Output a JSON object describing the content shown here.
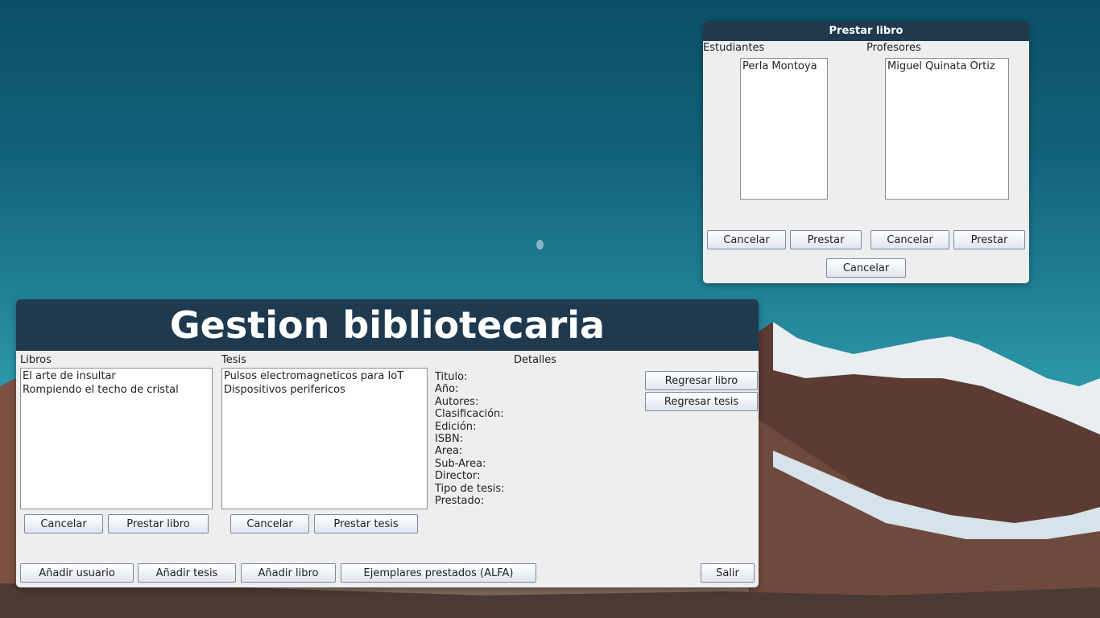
{
  "prestar_window": {
    "title": "Prestar libro",
    "students_label": "Estudiantes",
    "professors_label": "Profesores",
    "students": [
      "Perla Montoya"
    ],
    "professors": [
      "Miguel Quinata Ortiz"
    ],
    "buttons": {
      "cancel_students": "Cancelar",
      "lend_students": "Prestar",
      "cancel_professors": "Cancelar",
      "lend_professors": "Prestar",
      "cancel_bottom": "Cancelar"
    }
  },
  "main_window": {
    "title": "Gestion bibliotecaria",
    "books_label": "Libros",
    "books": [
      "El arte de insultar",
      "Rompiendo el techo de cristal"
    ],
    "thesis_label": "Tesis",
    "theses": [
      "Pulsos electromagneticos para IoT",
      "Dispositivos perifericos"
    ],
    "details_label": "Detalles",
    "details_fields": [
      "Titulo:",
      "Año:",
      "Autores:",
      "Clasificación:",
      "Edición:",
      "ISBN:",
      "Area:",
      "Sub-Area:",
      "Director:",
      "Tipo de tesis:",
      "Prestado:"
    ],
    "buttons": {
      "return_book": "Regresar libro",
      "return_thesis": "Regresar tesis",
      "cancel_books": "Cancelar",
      "lend_book": "Prestar libro",
      "cancel_thesis": "Cancelar",
      "lend_thesis": "Prestar tesis",
      "add_user": "Añadir usuario",
      "add_thesis": "Añadir tesis",
      "add_book": "Añadir libro",
      "borrowed_copies": "Ejemplares prestados (ALFA)",
      "exit": "Salir"
    }
  }
}
